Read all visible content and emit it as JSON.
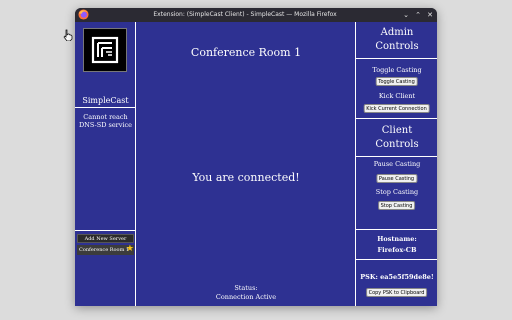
{
  "window": {
    "title": "Extension: (SimpleCast Client) - SimpleCast — Mozilla Firefox",
    "controls": {
      "minimize": "⌄",
      "maximize": "⌃",
      "close": "✕"
    }
  },
  "sidebar": {
    "app_name": "SimpleCast",
    "status_message": "Cannot reach DNS-SD service",
    "add_server_label": "Add New Server",
    "servers": [
      {
        "label": "Conference Room 1",
        "favorite": true
      }
    ]
  },
  "main": {
    "room_name": "Conference Room 1",
    "connection_message": "You are connected!",
    "status_label": "Status:",
    "status_value": "Connection Active"
  },
  "admin": {
    "heading": "Admin Controls",
    "toggle_label": "Toggle Casting",
    "toggle_button": "Toggle Casting",
    "kick_label": "Kick Client",
    "kick_button": "Kick Current Connection"
  },
  "client": {
    "heading": "Client Controls",
    "pause_label": "Pause Casting",
    "pause_button": "Pause Casting",
    "stop_label": "Stop Casting",
    "stop_button": "Stop Casting"
  },
  "info": {
    "hostname_label": "Hostname:",
    "hostname_value": "Firefox-CB",
    "psk_label": "PSK: ea5e5f59de8e!",
    "copy_button": "Copy PSK to Clipboard"
  },
  "icons": {
    "app_icon": "simplecast-logo-icon",
    "browser_icon": "firefox-icon",
    "favorite_icon": "star-icon",
    "cursor_icon": "hand-cursor-icon"
  },
  "colors": {
    "panel_bg": "#2e3192",
    "divider": "#ffffff",
    "star": "#f5c518",
    "titlebar": "#2b2a33"
  }
}
